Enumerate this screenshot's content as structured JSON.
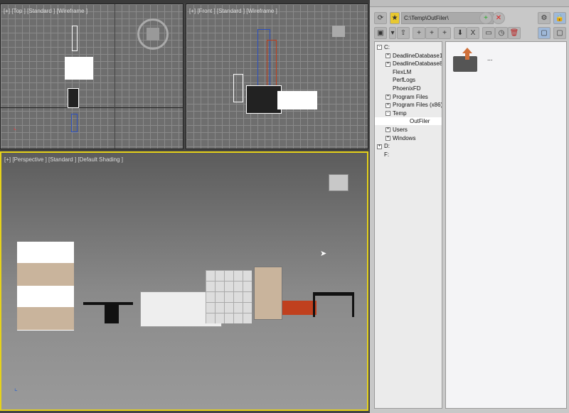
{
  "viewports": {
    "top": {
      "label": "[+] [Top ] [Standard ] [Wireframe ]"
    },
    "front": {
      "label": "[+] [Front ] [Standard ] [Wireframe ]"
    },
    "perspective": {
      "label": "[+] [Perspective ] [Standard ] [Default Shading ]"
    }
  },
  "panel": {
    "path": "C:\\Temp\\OutFiler\\",
    "tree": [
      {
        "label": "C:",
        "exp": "-",
        "lvl": 0
      },
      {
        "label": "DeadlineDatabase1",
        "exp": "+",
        "lvl": 1
      },
      {
        "label": "DeadlineDatabase8",
        "exp": "+",
        "lvl": 1
      },
      {
        "label": "FlexLM",
        "exp": "",
        "lvl": 1
      },
      {
        "label": "PerfLogs",
        "exp": "",
        "lvl": 1
      },
      {
        "label": "PhoenixFD",
        "exp": "",
        "lvl": 1
      },
      {
        "label": "Program Files",
        "exp": "+",
        "lvl": 1
      },
      {
        "label": "Program Files (x86)",
        "exp": "+",
        "lvl": 1
      },
      {
        "label": "Temp",
        "exp": "-",
        "lvl": 1
      },
      {
        "label": "OutFiler",
        "exp": "",
        "lvl": 2,
        "selected": true
      },
      {
        "label": "Users",
        "exp": "+",
        "lvl": 1
      },
      {
        "label": "Windows",
        "exp": "+",
        "lvl": 1
      },
      {
        "label": "D:",
        "exp": "+",
        "lvl": 0
      },
      {
        "label": "F:",
        "exp": "",
        "lvl": 0
      }
    ],
    "list_item": {
      "label": "...",
      "icon": "folder-up-icon"
    }
  },
  "colors": {
    "active_viewport": "#e6d21a",
    "selection": "#9fb8d8"
  }
}
